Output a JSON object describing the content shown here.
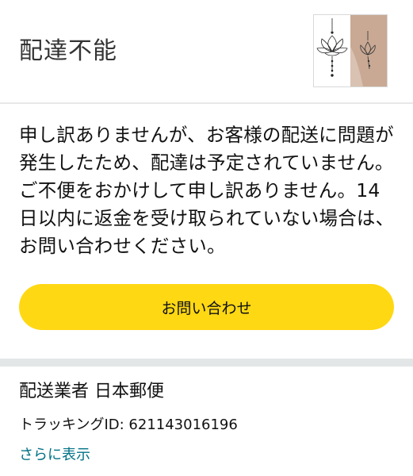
{
  "header": {
    "status_title": "配達不能",
    "thumbnail_icon": "tattoo-product-thumbnail"
  },
  "message": {
    "text": "申し訳ありませんが、お客様の配送に問題が発生したため、配達は予定されていません。ご不便をおかけして申し訳ありません。14日以内に返金を受け取られていない場合は、お問い合わせください。"
  },
  "contact_button": {
    "label": "お問い合わせ"
  },
  "shipment": {
    "carrier": "配送業者 日本郵便",
    "tracking": "トラッキングID: 621143016196",
    "show_more": "さらに表示"
  },
  "colors": {
    "button": "#ffd814",
    "link": "#007185",
    "divider": "#e3e6e6"
  }
}
